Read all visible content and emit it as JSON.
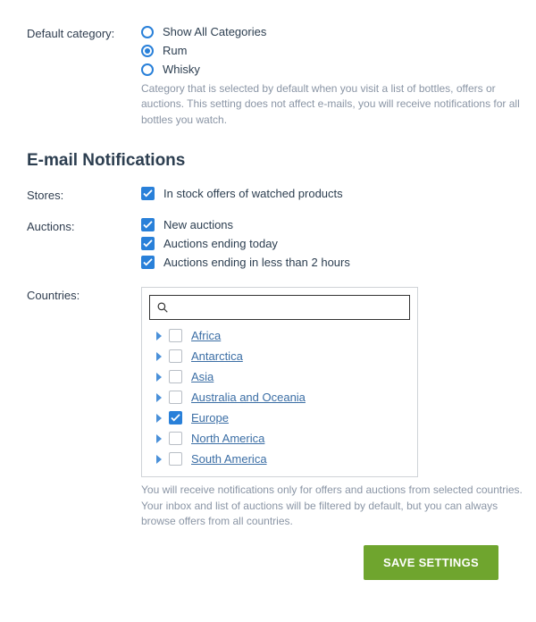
{
  "defaultCategory": {
    "label": "Default category:",
    "options": [
      {
        "label": "Show All Categories",
        "checked": false
      },
      {
        "label": "Rum",
        "checked": true
      },
      {
        "label": "Whisky",
        "checked": false
      }
    ],
    "help": "Category that is selected by default when you visit a list of bottles, offers or auctions. This setting does not affect e-mails, you will receive notifications for all bottles you watch."
  },
  "section_title": "E-mail Notifications",
  "stores": {
    "label": "Stores:",
    "items": [
      {
        "label": "In stock offers of watched products",
        "checked": true
      }
    ]
  },
  "auctions": {
    "label": "Auctions:",
    "items": [
      {
        "label": "New auctions",
        "checked": true
      },
      {
        "label": "Auctions ending today",
        "checked": true
      },
      {
        "label": "Auctions ending in less than 2 hours",
        "checked": true
      }
    ]
  },
  "countries": {
    "label": "Countries:",
    "search_placeholder": "",
    "items": [
      {
        "label": "Africa",
        "checked": false
      },
      {
        "label": "Antarctica",
        "checked": false
      },
      {
        "label": "Asia",
        "checked": false
      },
      {
        "label": "Australia and Oceania",
        "checked": false
      },
      {
        "label": "Europe",
        "checked": true
      },
      {
        "label": "North America",
        "checked": false
      },
      {
        "label": "South America",
        "checked": false
      }
    ],
    "help": "You will receive notifications only for offers and auctions from selected countries. Your inbox and list of auctions will be filtered by default, but you can always browse offers from all countries."
  },
  "save_label": "SAVE SETTINGS"
}
